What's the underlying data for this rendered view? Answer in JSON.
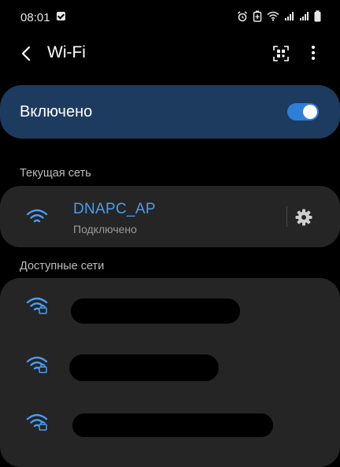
{
  "status_bar": {
    "time": "08:01",
    "icons": [
      "check-notification-icon",
      "alarm-icon",
      "battery-saver-icon",
      "wifi-status-icon",
      "signal-icon",
      "signal-icon",
      "battery-icon"
    ]
  },
  "toolbar": {
    "title": "Wi-Fi",
    "back_icon": "back-arrow-icon",
    "qr_icon": "qr-scan-icon",
    "more_icon": "more-vert-icon"
  },
  "master_switch": {
    "label": "Включено",
    "enabled": true
  },
  "current_network": {
    "section_title": "Текущая сеть",
    "name": "DNAPC_AP",
    "status": "Подключено",
    "settings_icon": "gear-icon"
  },
  "available_networks": {
    "section_title": "Доступные сети",
    "items": [
      {
        "name": "",
        "secured": true
      },
      {
        "name": "",
        "secured": true
      },
      {
        "name": "",
        "secured": true
      }
    ]
  },
  "colors": {
    "accent": "#4a9df0",
    "master_bg": "#1d3b5e",
    "card_bg": "#252525",
    "background": "#000000"
  }
}
